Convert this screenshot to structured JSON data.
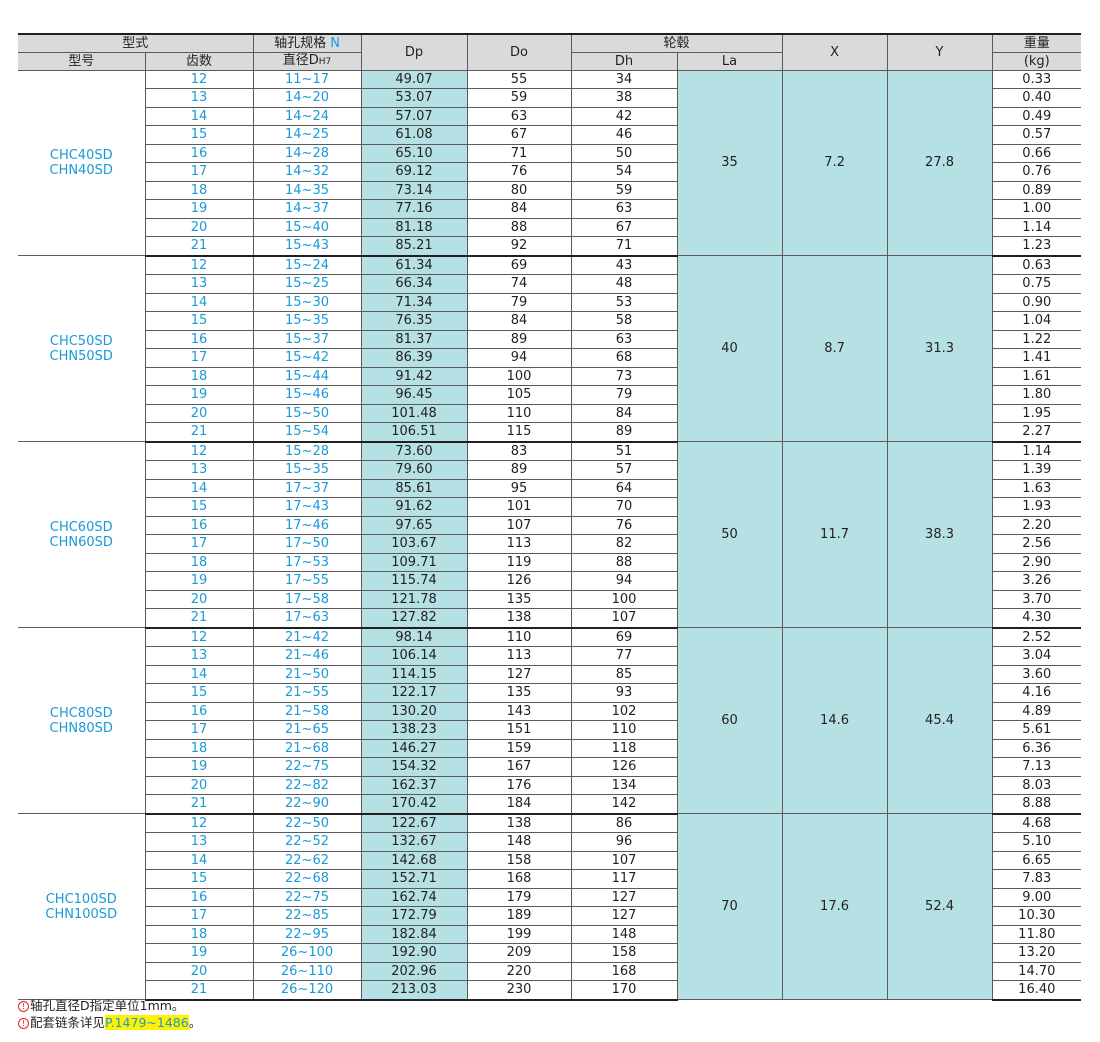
{
  "header": {
    "type_group": "型式",
    "model": "型号",
    "teeth": "齿数",
    "bore_spec_label": "轴孔规格",
    "bore_spec_n": "N",
    "bore_dia_label": "直径D",
    "bore_dia_sub": "H7",
    "dp": "Dp",
    "do": "Do",
    "hub_group": "轮毂",
    "dh": "Dh",
    "la": "La",
    "x": "X",
    "y": "Y",
    "weight": "重量",
    "weight_unit": "(kg)"
  },
  "groups": [
    {
      "model_line1": "CHC40SD",
      "model_line2": "CHN40SD",
      "la": "35",
      "x": "7.2",
      "y": "27.8",
      "rows": [
        {
          "teeth": "12",
          "bore": "11~17",
          "dp": "49.07",
          "do": "55",
          "dh": "34",
          "weight": "0.33"
        },
        {
          "teeth": "13",
          "bore": "14~20",
          "dp": "53.07",
          "do": "59",
          "dh": "38",
          "weight": "0.40"
        },
        {
          "teeth": "14",
          "bore": "14~24",
          "dp": "57.07",
          "do": "63",
          "dh": "42",
          "weight": "0.49"
        },
        {
          "teeth": "15",
          "bore": "14~25",
          "dp": "61.08",
          "do": "67",
          "dh": "46",
          "weight": "0.57"
        },
        {
          "teeth": "16",
          "bore": "14~28",
          "dp": "65.10",
          "do": "71",
          "dh": "50",
          "weight": "0.66"
        },
        {
          "teeth": "17",
          "bore": "14~32",
          "dp": "69.12",
          "do": "76",
          "dh": "54",
          "weight": "0.76"
        },
        {
          "teeth": "18",
          "bore": "14~35",
          "dp": "73.14",
          "do": "80",
          "dh": "59",
          "weight": "0.89"
        },
        {
          "teeth": "19",
          "bore": "14~37",
          "dp": "77.16",
          "do": "84",
          "dh": "63",
          "weight": "1.00"
        },
        {
          "teeth": "20",
          "bore": "15~40",
          "dp": "81.18",
          "do": "88",
          "dh": "67",
          "weight": "1.14"
        },
        {
          "teeth": "21",
          "bore": "15~43",
          "dp": "85.21",
          "do": "92",
          "dh": "71",
          "weight": "1.23"
        }
      ]
    },
    {
      "model_line1": "CHC50SD",
      "model_line2": "CHN50SD",
      "la": "40",
      "x": "8.7",
      "y": "31.3",
      "rows": [
        {
          "teeth": "12",
          "bore": "15~24",
          "dp": "61.34",
          "do": "69",
          "dh": "43",
          "weight": "0.63"
        },
        {
          "teeth": "13",
          "bore": "15~25",
          "dp": "66.34",
          "do": "74",
          "dh": "48",
          "weight": "0.75"
        },
        {
          "teeth": "14",
          "bore": "15~30",
          "dp": "71.34",
          "do": "79",
          "dh": "53",
          "weight": "0.90"
        },
        {
          "teeth": "15",
          "bore": "15~35",
          "dp": "76.35",
          "do": "84",
          "dh": "58",
          "weight": "1.04"
        },
        {
          "teeth": "16",
          "bore": "15~37",
          "dp": "81.37",
          "do": "89",
          "dh": "63",
          "weight": "1.22"
        },
        {
          "teeth": "17",
          "bore": "15~42",
          "dp": "86.39",
          "do": "94",
          "dh": "68",
          "weight": "1.41"
        },
        {
          "teeth": "18",
          "bore": "15~44",
          "dp": "91.42",
          "do": "100",
          "dh": "73",
          "weight": "1.61"
        },
        {
          "teeth": "19",
          "bore": "15~46",
          "dp": "96.45",
          "do": "105",
          "dh": "79",
          "weight": "1.80"
        },
        {
          "teeth": "20",
          "bore": "15~50",
          "dp": "101.48",
          "do": "110",
          "dh": "84",
          "weight": "1.95"
        },
        {
          "teeth": "21",
          "bore": "15~54",
          "dp": "106.51",
          "do": "115",
          "dh": "89",
          "weight": "2.27"
        }
      ]
    },
    {
      "model_line1": "CHC60SD",
      "model_line2": "CHN60SD",
      "la": "50",
      "x": "11.7",
      "y": "38.3",
      "rows": [
        {
          "teeth": "12",
          "bore": "15~28",
          "dp": "73.60",
          "do": "83",
          "dh": "51",
          "weight": "1.14"
        },
        {
          "teeth": "13",
          "bore": "15~35",
          "dp": "79.60",
          "do": "89",
          "dh": "57",
          "weight": "1.39"
        },
        {
          "teeth": "14",
          "bore": "17~37",
          "dp": "85.61",
          "do": "95",
          "dh": "64",
          "weight": "1.63"
        },
        {
          "teeth": "15",
          "bore": "17~43",
          "dp": "91.62",
          "do": "101",
          "dh": "70",
          "weight": "1.93"
        },
        {
          "teeth": "16",
          "bore": "17~46",
          "dp": "97.65",
          "do": "107",
          "dh": "76",
          "weight": "2.20"
        },
        {
          "teeth": "17",
          "bore": "17~50",
          "dp": "103.67",
          "do": "113",
          "dh": "82",
          "weight": "2.56"
        },
        {
          "teeth": "18",
          "bore": "17~53",
          "dp": "109.71",
          "do": "119",
          "dh": "88",
          "weight": "2.90"
        },
        {
          "teeth": "19",
          "bore": "17~55",
          "dp": "115.74",
          "do": "126",
          "dh": "94",
          "weight": "3.26"
        },
        {
          "teeth": "20",
          "bore": "17~58",
          "dp": "121.78",
          "do": "135",
          "dh": "100",
          "weight": "3.70"
        },
        {
          "teeth": "21",
          "bore": "17~63",
          "dp": "127.82",
          "do": "138",
          "dh": "107",
          "weight": "4.30"
        }
      ]
    },
    {
      "model_line1": "CHC80SD",
      "model_line2": "CHN80SD",
      "la": "60",
      "x": "14.6",
      "y": "45.4",
      "rows": [
        {
          "teeth": "12",
          "bore": "21~42",
          "dp": "98.14",
          "do": "110",
          "dh": "69",
          "weight": "2.52"
        },
        {
          "teeth": "13",
          "bore": "21~46",
          "dp": "106.14",
          "do": "113",
          "dh": "77",
          "weight": "3.04"
        },
        {
          "teeth": "14",
          "bore": "21~50",
          "dp": "114.15",
          "do": "127",
          "dh": "85",
          "weight": "3.60"
        },
        {
          "teeth": "15",
          "bore": "21~55",
          "dp": "122.17",
          "do": "135",
          "dh": "93",
          "weight": "4.16"
        },
        {
          "teeth": "16",
          "bore": "21~58",
          "dp": "130.20",
          "do": "143",
          "dh": "102",
          "weight": "4.89"
        },
        {
          "teeth": "17",
          "bore": "21~65",
          "dp": "138.23",
          "do": "151",
          "dh": "110",
          "weight": "5.61"
        },
        {
          "teeth": "18",
          "bore": "21~68",
          "dp": "146.27",
          "do": "159",
          "dh": "118",
          "weight": "6.36"
        },
        {
          "teeth": "19",
          "bore": "22~75",
          "dp": "154.32",
          "do": "167",
          "dh": "126",
          "weight": "7.13"
        },
        {
          "teeth": "20",
          "bore": "22~82",
          "dp": "162.37",
          "do": "176",
          "dh": "134",
          "weight": "8.03"
        },
        {
          "teeth": "21",
          "bore": "22~90",
          "dp": "170.42",
          "do": "184",
          "dh": "142",
          "weight": "8.88"
        }
      ]
    },
    {
      "model_line1": "CHC100SD",
      "model_line2": "CHN100SD",
      "la": "70",
      "x": "17.6",
      "y": "52.4",
      "rows": [
        {
          "teeth": "12",
          "bore": "22~50",
          "dp": "122.67",
          "do": "138",
          "dh": "86",
          "weight": "4.68"
        },
        {
          "teeth": "13",
          "bore": "22~52",
          "dp": "132.67",
          "do": "148",
          "dh": "96",
          "weight": "5.10"
        },
        {
          "teeth": "14",
          "bore": "22~62",
          "dp": "142.68",
          "do": "158",
          "dh": "107",
          "weight": "6.65"
        },
        {
          "teeth": "15",
          "bore": "22~68",
          "dp": "152.71",
          "do": "168",
          "dh": "117",
          "weight": "7.83"
        },
        {
          "teeth": "16",
          "bore": "22~75",
          "dp": "162.74",
          "do": "179",
          "dh": "127",
          "weight": "9.00"
        },
        {
          "teeth": "17",
          "bore": "22~85",
          "dp": "172.79",
          "do": "189",
          "dh": "127",
          "weight": "10.30"
        },
        {
          "teeth": "18",
          "bore": "22~95",
          "dp": "182.84",
          "do": "199",
          "dh": "148",
          "weight": "11.80"
        },
        {
          "teeth": "19",
          "bore": "26~100",
          "dp": "192.90",
          "do": "209",
          "dh": "158",
          "weight": "13.20"
        },
        {
          "teeth": "20",
          "bore": "26~110",
          "dp": "202.96",
          "do": "220",
          "dh": "168",
          "weight": "14.70"
        },
        {
          "teeth": "21",
          "bore": "26~120",
          "dp": "213.03",
          "do": "230",
          "dh": "170",
          "weight": "16.40"
        }
      ]
    }
  ],
  "notes": {
    "icon": "!",
    "note1": "轴孔直径D指定单位1mm。",
    "note2_prefix": "配套链条详见",
    "note2_link": "P.1479~1486",
    "note2_suffix": "。"
  },
  "colors": {
    "accent_blue": "#1a9ad6",
    "shade_cyan": "#b6e1e4",
    "header_gray": "#d9dadb",
    "note_red": "#e8202a",
    "highlight_yellow": "#fff200"
  }
}
